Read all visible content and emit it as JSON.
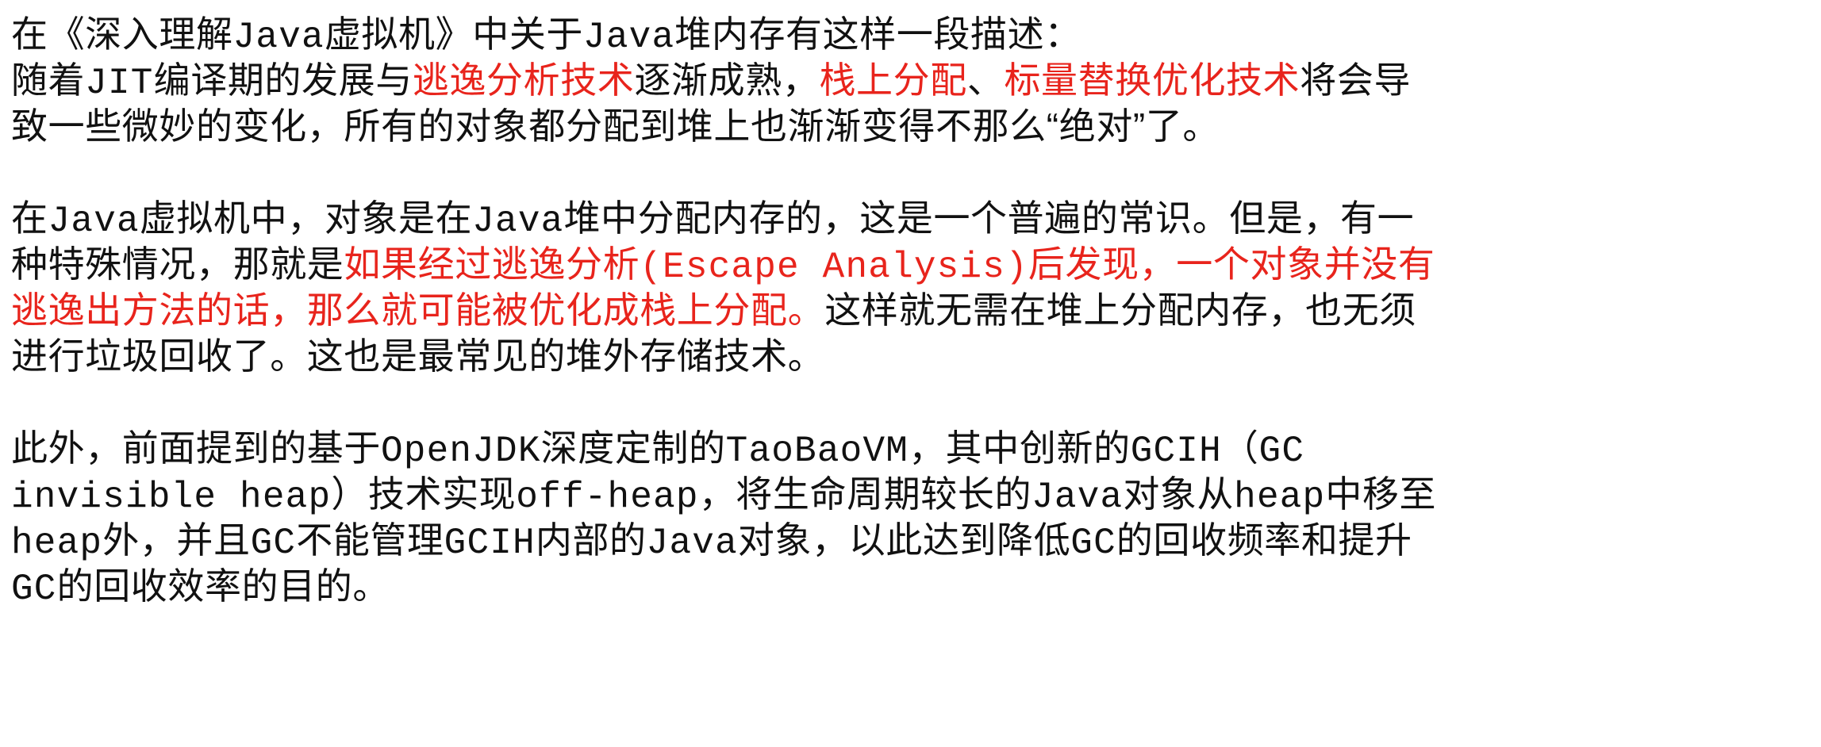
{
  "accent_color": "#e8241c",
  "paragraphs": [
    {
      "lines": [
        [
          {
            "t": "在《深入理解",
            "s": "n"
          },
          {
            "t": "Java",
            "s": "m"
          },
          {
            "t": "虚拟机》中关于",
            "s": "n"
          },
          {
            "t": "Java",
            "s": "m"
          },
          {
            "t": "堆内存有这样一段描述：",
            "s": "n"
          }
        ],
        [
          {
            "t": "随着",
            "s": "n"
          },
          {
            "t": "JIT",
            "s": "m"
          },
          {
            "t": "编译期的发展与",
            "s": "n"
          },
          {
            "t": "逃逸分析技术",
            "s": "r"
          },
          {
            "t": "逐渐成熟，",
            "s": "n"
          },
          {
            "t": "栈上分配",
            "s": "r"
          },
          {
            "t": "、",
            "s": "n"
          },
          {
            "t": "标量替换优化技术",
            "s": "r"
          },
          {
            "t": "将会导",
            "s": "n"
          }
        ],
        [
          {
            "t": "致一些微妙的变化，所有的对象都分配到堆上也渐渐变得不那么“绝对”了。",
            "s": "n"
          }
        ]
      ]
    },
    {
      "lines": [
        [
          {
            "t": "在",
            "s": "n"
          },
          {
            "t": "Java",
            "s": "m"
          },
          {
            "t": "虚拟机中，对象是在",
            "s": "n"
          },
          {
            "t": "Java",
            "s": "m"
          },
          {
            "t": "堆中分配内存的，这是一个普遍的常识。但是，有一",
            "s": "n"
          }
        ],
        [
          {
            "t": "种特殊情况，那就是",
            "s": "n"
          },
          {
            "t": "如果经过逃逸分析",
            "s": "r"
          },
          {
            "t": "(Escape Analysis)",
            "s": "rm"
          },
          {
            "t": "后发现，一个对象并没有",
            "s": "r"
          }
        ],
        [
          {
            "t": "逃逸出方法的话，那么就可能被优化成栈上分配。",
            "s": "r"
          },
          {
            "t": "这样就无需在堆上分配内存，也无须",
            "s": "n"
          }
        ],
        [
          {
            "t": "进行垃圾回收了。这也是最常见的堆外存储技术。",
            "s": "n"
          }
        ]
      ]
    },
    {
      "lines": [
        [
          {
            "t": "此外，前面提到的基于",
            "s": "n"
          },
          {
            "t": "OpenJDK",
            "s": "m"
          },
          {
            "t": "深度定制的",
            "s": "n"
          },
          {
            "t": "TaoBaoVM",
            "s": "m"
          },
          {
            "t": "，其中创新的",
            "s": "n"
          },
          {
            "t": "GCIH",
            "s": "m"
          },
          {
            "t": "（",
            "s": "n"
          },
          {
            "t": "GC",
            "s": "m"
          }
        ],
        [
          {
            "t": "invisible heap",
            "s": "m"
          },
          {
            "t": "）技术实现",
            "s": "n"
          },
          {
            "t": "off-heap",
            "s": "m"
          },
          {
            "t": "，将生命周期较长的",
            "s": "n"
          },
          {
            "t": "Java",
            "s": "m"
          },
          {
            "t": "对象从",
            "s": "n"
          },
          {
            "t": "heap",
            "s": "m"
          },
          {
            "t": "中移至",
            "s": "n"
          }
        ],
        [
          {
            "t": "heap",
            "s": "m"
          },
          {
            "t": "外，并且",
            "s": "n"
          },
          {
            "t": "GC",
            "s": "m"
          },
          {
            "t": "不能管理",
            "s": "n"
          },
          {
            "t": "GCIH",
            "s": "m"
          },
          {
            "t": "内部的",
            "s": "n"
          },
          {
            "t": "Java",
            "s": "m"
          },
          {
            "t": "对象，以此达到降低",
            "s": "n"
          },
          {
            "t": "GC",
            "s": "m"
          },
          {
            "t": "的回收频率和提升",
            "s": "n"
          }
        ],
        [
          {
            "t": "GC",
            "s": "m"
          },
          {
            "t": "的回收效率的目的。",
            "s": "n"
          }
        ]
      ]
    }
  ]
}
